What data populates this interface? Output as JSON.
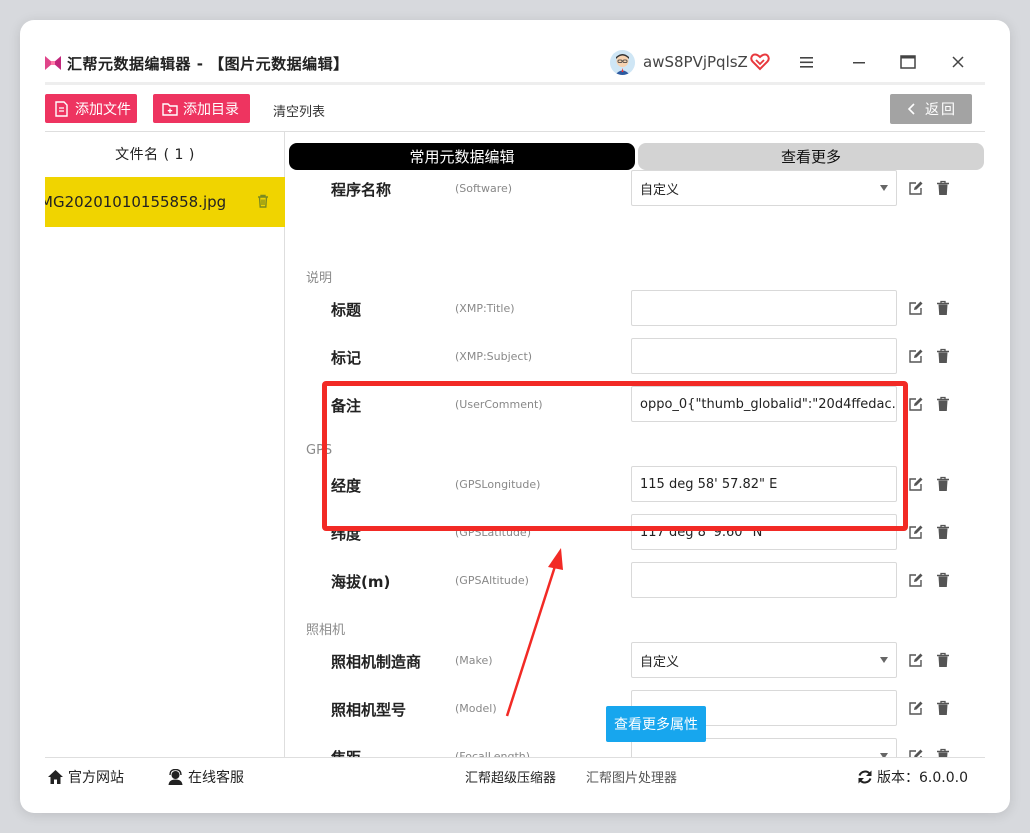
{
  "window": {
    "title": "汇帮元数据编辑器 - 【图片元数据编辑】",
    "username": "awS8PVjPqlsZ",
    "colors": {
      "accent": "#ee3460",
      "selected_file_bg": "#f0d400",
      "highlight_border": "#f22a25",
      "info_button": "#17a6ee"
    }
  },
  "toolbar": {
    "add_file": "添加文件",
    "add_dir": "添加目录",
    "clear_list": "清空列表",
    "back": "返回"
  },
  "file_list": {
    "header": "文件名 ( 1 )",
    "files": [
      {
        "name": "MG20201010155858.jpg"
      }
    ]
  },
  "tabs": {
    "common": "常用元数据编辑",
    "more": "查看更多"
  },
  "sections": {
    "desc": "说明",
    "gps": "GPS",
    "camera": "照相机"
  },
  "rows": [
    {
      "label": "程序名称",
      "key": "(Software)",
      "value": "自定义",
      "type": "select"
    },
    {
      "label": "标题",
      "key": "(XMP:Title)",
      "value": "",
      "type": "text"
    },
    {
      "label": "标记",
      "key": "(XMP:Subject)",
      "value": "",
      "type": "text"
    },
    {
      "label": "备注",
      "key": "(UserComment)",
      "value": "oppo_0{\"thumb_globalid\":\"20d4ffedac...",
      "type": "text"
    },
    {
      "label": "经度",
      "key": "(GPSLongitude)",
      "value": "115 deg 58' 57.82\" E",
      "type": "text"
    },
    {
      "label": "纬度",
      "key": "(GPSLatitude)",
      "value": "117 deg 8' 9.60\" N",
      "type": "text"
    },
    {
      "label": "海拔(m)",
      "key": "(GPSAltitude)",
      "value": "",
      "type": "text"
    },
    {
      "label": "照相机制造商",
      "key": "(Make)",
      "value": "自定义",
      "type": "select"
    },
    {
      "label": "照相机型号",
      "key": "(Model)",
      "value": "",
      "type": "text"
    },
    {
      "label": "焦距",
      "key": "(FocalLength)",
      "value": "",
      "type": "select"
    }
  ],
  "more_properties_button": "查看更多属性",
  "footer": {
    "website": "官方网站",
    "service": "在线客服",
    "compressor": "汇帮超级压缩器",
    "image_tool": "汇帮图片处理器",
    "version": "版本：6.0.0.0"
  }
}
